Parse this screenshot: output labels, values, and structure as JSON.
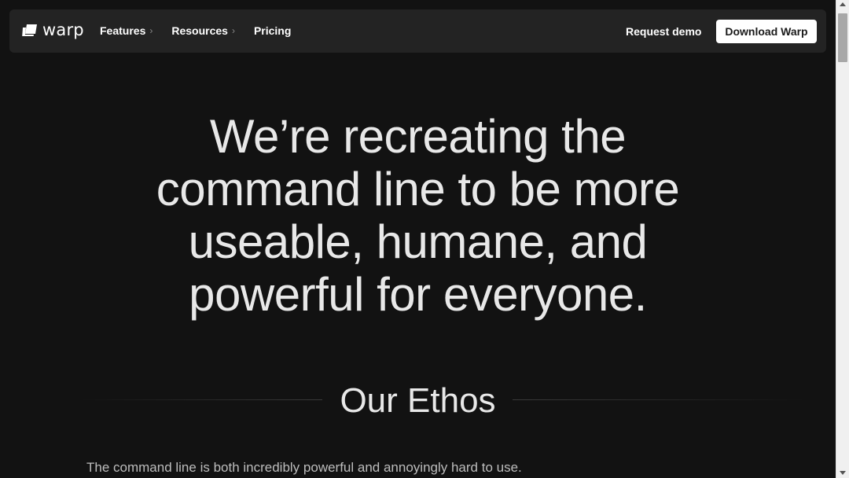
{
  "nav": {
    "logo_text": "warp",
    "links": [
      {
        "label": "Features",
        "chevron": "›"
      },
      {
        "label": "Resources",
        "chevron": "›"
      },
      {
        "label": "Pricing"
      }
    ],
    "request_demo": "Request demo",
    "download": "Download Warp"
  },
  "hero": {
    "lines": [
      "We’re recreating the",
      "command line to be more",
      "useable, humane, and",
      "powerful for everyone."
    ]
  },
  "ethos": {
    "title": "Our Ethos",
    "body": "The command line is both incredibly powerful and annoyingly hard to use."
  },
  "icons": {
    "logo": "warp-logo-icon",
    "chevron": "chevron-right-icon",
    "scroll_up": "arrow-up-icon",
    "scroll_down": "arrow-down-icon"
  },
  "colors": {
    "background": "#121212",
    "navbar": "#232323",
    "text": "#e8e8e8",
    "button_bg": "#ffffff",
    "button_text": "#1a1a1a"
  }
}
